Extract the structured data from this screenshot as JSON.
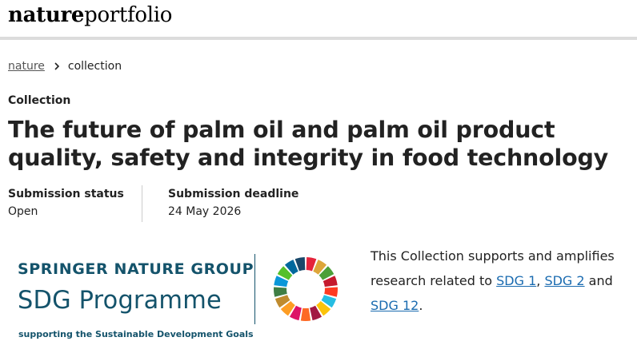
{
  "header": {
    "logo_primary": "nature",
    "logo_secondary": "portfolio"
  },
  "breadcrumb": {
    "items": [
      {
        "label": "nature",
        "is_link": true
      },
      {
        "label": "collection",
        "is_link": false
      }
    ],
    "separator_icon": "chevron-right-icon"
  },
  "collection": {
    "eyebrow": "Collection",
    "title": "The future of palm oil and palm oil product quality, safety and integrity in food technology"
  },
  "submission": {
    "status_label": "Submission status",
    "status_value": "Open",
    "deadline_label": "Submission deadline",
    "deadline_value": "24 May 2026"
  },
  "sdg_banner": {
    "group_text_part1": "Springer ",
    "group_text_part2": "Nature Group",
    "programme_text": "SDG Programme",
    "tagline": "supporting the Sustainable Development Goals",
    "brand_color": "#14536b",
    "wheel_icon": "sdg-wheel-icon",
    "wheel_colors": [
      "#e5243b",
      "#dda63a",
      "#4c9f38",
      "#c5192d",
      "#ff3a21",
      "#26bde2",
      "#fcc30b",
      "#a21942",
      "#fd6925",
      "#dd1367",
      "#fd9d24",
      "#bf8b2e",
      "#3f7e44",
      "#0a97d9",
      "#56c02b",
      "#00689d",
      "#19486a"
    ]
  },
  "support": {
    "text_before": "This Collection supports and amplifies research related to ",
    "link1": "SDG 1",
    "sep1": ", ",
    "link2": "SDG 2",
    "sep2": " and ",
    "link3": "SDG 12",
    "text_after": "."
  }
}
